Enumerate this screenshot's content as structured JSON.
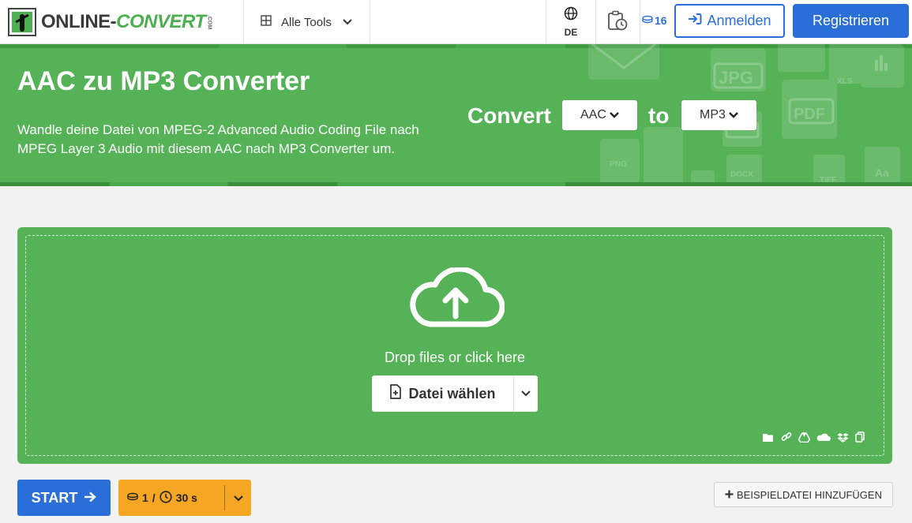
{
  "header": {
    "logo": {
      "text_main": "ONLINE-",
      "text_accent": "CONVERT",
      "text_sub": ".COM"
    },
    "tools_label": "Alle Tools",
    "language_code": "DE",
    "credits_count": "16",
    "login_label": "Anmelden",
    "register_label": "Registrieren"
  },
  "hero": {
    "title": "AAC zu MP3 Converter",
    "description": "Wandle deine Datei von MPEG-2 Advanced Audio Coding File nach MPEG Layer 3 Audio mit diesem AAC nach MP3 Converter um.",
    "convert_label": "Convert",
    "to_label": "to",
    "from_format": "AAC",
    "to_format": "MP3"
  },
  "dropzone": {
    "prompt": "Drop files or click here",
    "choose_label": "Datei wählen",
    "sources": [
      "folder-icon",
      "link-icon",
      "google-drive-icon",
      "onedrive-icon",
      "dropbox-icon",
      "clipboard-icon"
    ]
  },
  "actions": {
    "start_label": "START",
    "cost_credits": "1",
    "cost_separator": "/",
    "cost_time": "30 s",
    "example_label": "BEISPIELDATEI HINZUFÜGEN"
  },
  "colors": {
    "brand_green": "#55b257",
    "primary_blue": "#2a6ed8",
    "cost_orange": "#f5a623"
  }
}
